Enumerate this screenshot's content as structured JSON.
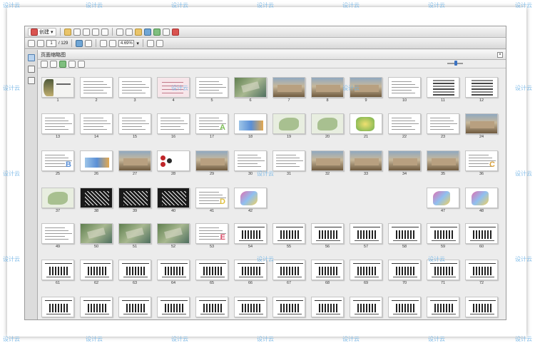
{
  "toolbar": {
    "create_label": "创建",
    "page_current": "1",
    "page_total": "/ 129",
    "zoom": "4.69%"
  },
  "panel": {
    "title": "页面缩略图"
  },
  "watermark": "设计云",
  "pages": [
    {
      "n": "1",
      "style": "cover"
    },
    {
      "n": "2",
      "style": "text"
    },
    {
      "n": "3",
      "style": "text"
    },
    {
      "n": "4",
      "style": "pink"
    },
    {
      "n": "5",
      "style": "text"
    },
    {
      "n": "6",
      "style": "aerial"
    },
    {
      "n": "7",
      "style": "photo"
    },
    {
      "n": "8",
      "style": "photo"
    },
    {
      "n": "9",
      "style": "photo"
    },
    {
      "n": "10",
      "style": "text"
    },
    {
      "n": "11",
      "style": "table"
    },
    {
      "n": "12",
      "style": "table"
    },
    {
      "n": "13",
      "style": "text"
    },
    {
      "n": "14",
      "style": "text"
    },
    {
      "n": "15",
      "style": "text"
    },
    {
      "n": "16",
      "style": "text"
    },
    {
      "n": "17",
      "style": "letterA",
      "letter": "A"
    },
    {
      "n": "18",
      "style": "chart"
    },
    {
      "n": "19",
      "style": "map"
    },
    {
      "n": "20",
      "style": "map"
    },
    {
      "n": "21",
      "style": "green"
    },
    {
      "n": "22",
      "style": "text"
    },
    {
      "n": "23",
      "style": "text"
    },
    {
      "n": "24",
      "style": "photo"
    },
    {
      "n": "25",
      "style": "letterB",
      "letter": "B"
    },
    {
      "n": "26",
      "style": "chart"
    },
    {
      "n": "27",
      "style": "photo"
    },
    {
      "n": "28",
      "style": "red"
    },
    {
      "n": "29",
      "style": "photo"
    },
    {
      "n": "30",
      "style": "text"
    },
    {
      "n": "31",
      "style": "text"
    },
    {
      "n": "32",
      "style": "photo"
    },
    {
      "n": "33",
      "style": "photo"
    },
    {
      "n": "34",
      "style": "photo"
    },
    {
      "n": "35",
      "style": "photo"
    },
    {
      "n": "36",
      "style": "letterC",
      "letter": "C"
    },
    {
      "n": "37",
      "style": "map"
    },
    {
      "n": "38",
      "style": "dark"
    },
    {
      "n": "39",
      "style": "dark"
    },
    {
      "n": "40",
      "style": "dark"
    },
    {
      "n": "41",
      "style": "letterD",
      "letter": "D"
    },
    {
      "n": "42",
      "style": "colormap"
    },
    {
      "n": "47",
      "style": "colormap"
    },
    {
      "n": "48",
      "style": "colormap"
    },
    {
      "n": "49",
      "style": "text"
    },
    {
      "n": "50",
      "style": "aerial"
    },
    {
      "n": "51",
      "style": "aerial"
    },
    {
      "n": "52",
      "style": "aerial"
    },
    {
      "n": "53",
      "style": "letterE",
      "letter": "E"
    },
    {
      "n": "54",
      "style": "plan"
    },
    {
      "n": "55",
      "style": "plan"
    },
    {
      "n": "56",
      "style": "plan"
    },
    {
      "n": "57",
      "style": "plan"
    },
    {
      "n": "58",
      "style": "plan"
    },
    {
      "n": "59",
      "style": "plan"
    },
    {
      "n": "60",
      "style": "plan"
    },
    {
      "n": "61",
      "style": "plan"
    },
    {
      "n": "62",
      "style": "plan"
    },
    {
      "n": "63",
      "style": "plan"
    },
    {
      "n": "64",
      "style": "plan"
    },
    {
      "n": "65",
      "style": "plan"
    },
    {
      "n": "66",
      "style": "plan"
    },
    {
      "n": "67",
      "style": "plan"
    },
    {
      "n": "68",
      "style": "plan"
    },
    {
      "n": "69",
      "style": "plan"
    },
    {
      "n": "70",
      "style": "plan"
    },
    {
      "n": "71",
      "style": "plan"
    },
    {
      "n": "72",
      "style": "plan"
    },
    {
      "n": "",
      "style": "plan"
    },
    {
      "n": "",
      "style": "plan"
    },
    {
      "n": "",
      "style": "plan"
    },
    {
      "n": "",
      "style": "plan"
    },
    {
      "n": "",
      "style": "plan"
    },
    {
      "n": "",
      "style": "plan"
    },
    {
      "n": "",
      "style": "plan"
    },
    {
      "n": "",
      "style": "plan"
    },
    {
      "n": "",
      "style": "plan"
    },
    {
      "n": "",
      "style": "plan"
    },
    {
      "n": "",
      "style": "plan"
    },
    {
      "n": "",
      "style": "plan"
    }
  ]
}
